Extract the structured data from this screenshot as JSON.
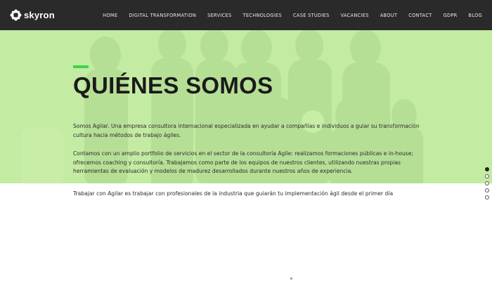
{
  "brand": {
    "name": "skyron",
    "logo_icon": "gear-flower-icon"
  },
  "nav": {
    "items": [
      "HOME",
      "DIGITAL TRANSFORMATION",
      "SERVICES",
      "TECHNOLOGIES",
      "CASE STUDIES",
      "VACANCIES",
      "ABOUT",
      "CONTACT",
      "GDPR",
      "BLOG"
    ]
  },
  "hero": {
    "title": "QUIÉNES SOMOS",
    "paragraphs": [
      "Somos Agilar. Una empresa consultora internacional especializada en ayudar a compañías e individuos a guiar su transformación cultura hacia métodos de trabajo ágiles.",
      "Contamos con un amplio portfolio de servicios en el sector de la consultoría Agile: realizamos formaciones públicas e in-house; ofrecemos coaching y consultoría. Trabajamos como parte de los equipos de nuestros clientes, utilizando nuestras propias herramientas de evaluación y modelos de madurez desarrollados durante nuestros años de experiencia.",
      "Trabajar con Agilar es trabajar con profesionales de la industria que guiarán tu implementación ágil desde el primer día"
    ]
  },
  "colors": {
    "nav_bg": "#2a2a2a",
    "hero_tint": "#c7f4a2",
    "accent": "#3ad64a"
  },
  "slider": {
    "count": 5,
    "active_index": 0
  }
}
